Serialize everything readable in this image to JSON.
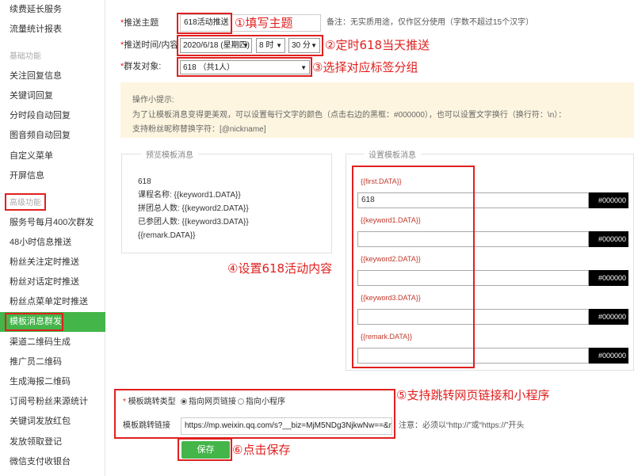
{
  "sidebar": {
    "items": [
      {
        "label": "续费延长服务",
        "group": false,
        "active": false
      },
      {
        "label": "流量统计报表",
        "group": false,
        "active": false
      },
      {
        "label": "基础功能",
        "group": true,
        "active": false
      },
      {
        "label": "关注回复信息",
        "group": false,
        "active": false
      },
      {
        "label": "关键词回复",
        "group": false,
        "active": false
      },
      {
        "label": "分时段自动回复",
        "group": false,
        "active": false
      },
      {
        "label": "图音频自动回复",
        "group": false,
        "active": false
      },
      {
        "label": "自定义菜单",
        "group": false,
        "active": false
      },
      {
        "label": "开屏信息",
        "group": false,
        "active": false
      },
      {
        "label": "高级功能",
        "group": true,
        "active": false
      },
      {
        "label": "服务号每月400次群发",
        "group": false,
        "active": false
      },
      {
        "label": "48小时信息推送",
        "group": false,
        "active": false
      },
      {
        "label": "粉丝关注定时推送",
        "group": false,
        "active": false
      },
      {
        "label": "粉丝对话定时推送",
        "group": false,
        "active": false
      },
      {
        "label": "粉丝点菜单定时推送",
        "group": false,
        "active": false
      },
      {
        "label": "模板消息群发",
        "group": false,
        "active": true
      },
      {
        "label": "渠道二维码生成",
        "group": false,
        "active": false
      },
      {
        "label": "推广员二维码",
        "group": false,
        "active": false
      },
      {
        "label": "生成海报二维码",
        "group": false,
        "active": false
      },
      {
        "label": "订阅号粉丝来源统计",
        "group": false,
        "active": false
      },
      {
        "label": "关键词发放红包",
        "group": false,
        "active": false
      },
      {
        "label": "发放领取登记",
        "group": false,
        "active": false
      },
      {
        "label": "微信支付收银台",
        "group": false,
        "active": false
      }
    ]
  },
  "form": {
    "required_mark": "*",
    "topic_label": "推送主题",
    "topic_value": "618活动推送",
    "topic_note": "备注：无实质用途，仅作区分使用（字数不超过15个汉字）",
    "time_label": "推送时间/内容",
    "date_value": "2020/6/18 (星期四)",
    "hour_value": "8 时",
    "minute_value": "30 分",
    "target_label": "群发对象:",
    "target_value": "618 （共1人）"
  },
  "tips": {
    "title": "操作小提示:",
    "line1": "为了让模板消息变得更美观，可以设置每行文字的颜色（点击右边的黑框：#000000），也可以设置文字换行（换行符：\\n）：",
    "line2": "支持粉丝昵称替换字符：[@nickname]"
  },
  "preview": {
    "title": "预览模板消息",
    "lines": [
      "618",
      "课程名称: {{keyword1.DATA}}",
      "拼团总人数: {{keyword2.DATA}}",
      "已参团人数: {{keyword3.DATA}}",
      "{{remark.DATA}}"
    ]
  },
  "settings": {
    "title": "设置模板消息",
    "fields": [
      {
        "key": "{{first.DATA}}",
        "value": "618",
        "color": "#000000"
      },
      {
        "key": "{{keyword1.DATA}}",
        "value": "",
        "color": "#000000"
      },
      {
        "key": "{{keyword2.DATA}}",
        "value": "",
        "color": "#000000"
      },
      {
        "key": "{{keyword3.DATA}}",
        "value": "",
        "color": "#000000"
      },
      {
        "key": "{{remark.DATA}}",
        "value": "",
        "color": "#000000"
      }
    ]
  },
  "jump": {
    "type_label": "模板跳转类型",
    "option_web": "指向网页链接",
    "option_mini": "指向小程序",
    "link_label": "模板跳转链接",
    "link_value": "https://mp.weixin.qq.com/s?__biz=MjM5NDg3NjkwNw==&mid",
    "link_note": "注意：必须以“http://”或“https://”开头"
  },
  "save_label": "保存",
  "annotations": {
    "a1": "①填写主题",
    "a2": "②定时618当天推送",
    "a3": "③选择对应标签分组",
    "a4": "④设置618活动内容",
    "a5": "⑤支持跳转网页链接和小程序",
    "a6": "⑥点击保存"
  },
  "colors": {
    "accent": "#44b549",
    "annotation": "#e02020",
    "tip_bg": "#fdf5df"
  }
}
